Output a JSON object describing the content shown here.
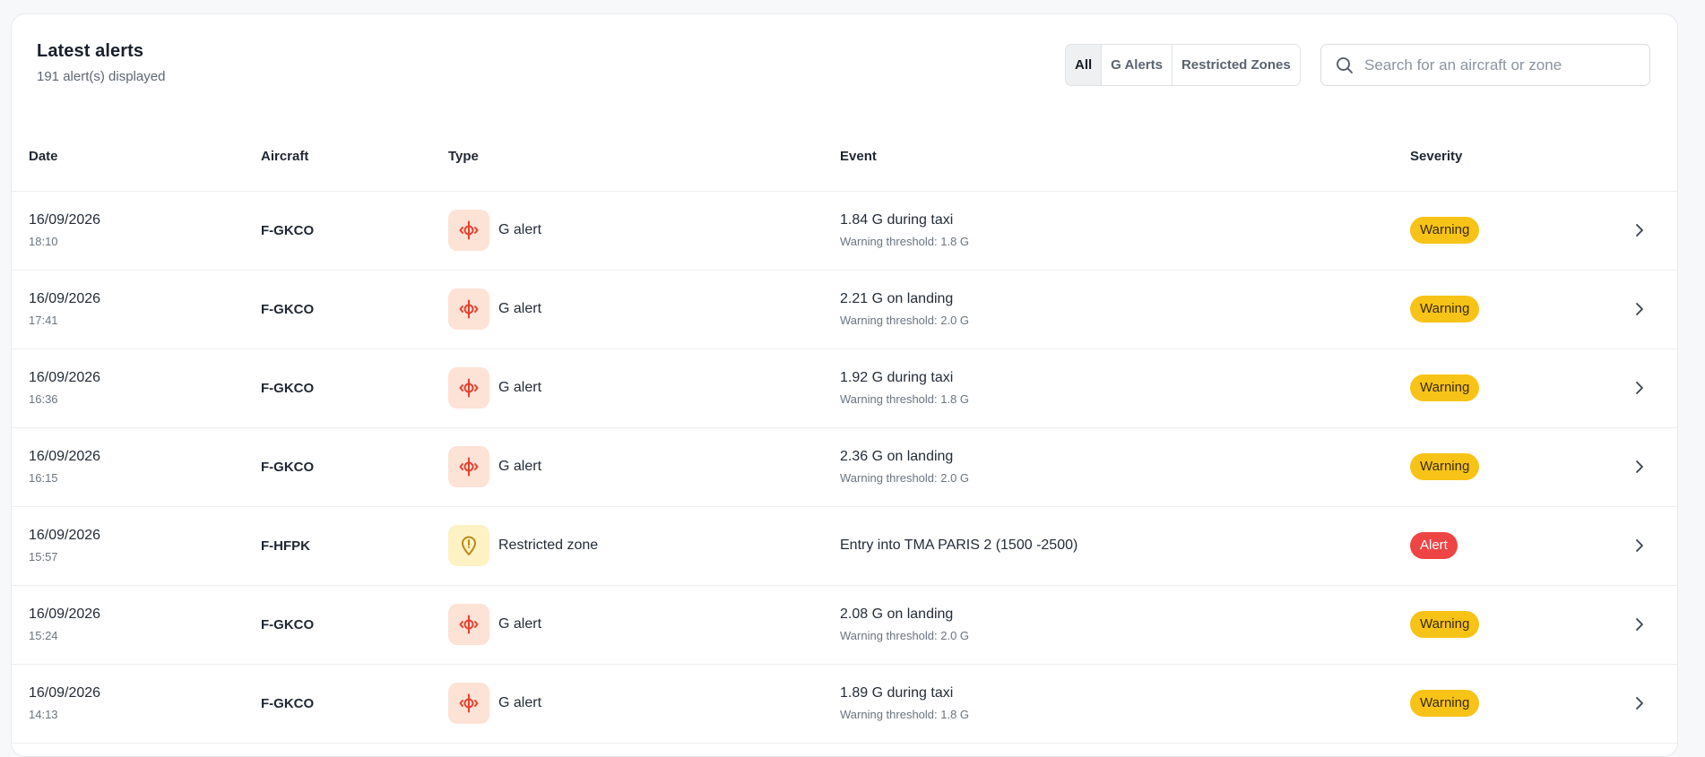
{
  "header": {
    "title": "Latest alerts",
    "subtitle": "191 alert(s) displayed"
  },
  "filters": [
    {
      "label": "All",
      "active": true
    },
    {
      "label": "G Alerts",
      "active": false
    },
    {
      "label": "Restricted Zones",
      "active": false
    }
  ],
  "search": {
    "placeholder": "Search for an aircraft or zone",
    "value": ""
  },
  "table": {
    "columns": [
      "Date",
      "Aircraft",
      "Type",
      "Event",
      "Severity"
    ],
    "rows": [
      {
        "date": "16/09/2026",
        "time": "18:10",
        "aircraft": "F-GKCO",
        "type": "G alert",
        "type_icon": "g-force-icon",
        "event": "1.84 G during taxi",
        "threshold": "Warning threshold: 1.8 G",
        "severity": "Warning"
      },
      {
        "date": "16/09/2026",
        "time": "17:41",
        "aircraft": "F-GKCO",
        "type": "G alert",
        "type_icon": "g-force-icon",
        "event": "2.21 G on landing",
        "threshold": "Warning threshold: 2.0 G",
        "severity": "Warning"
      },
      {
        "date": "16/09/2026",
        "time": "16:36",
        "aircraft": "F-GKCO",
        "type": "G alert",
        "type_icon": "g-force-icon",
        "event": "1.92 G during taxi",
        "threshold": "Warning threshold: 1.8 G",
        "severity": "Warning"
      },
      {
        "date": "16/09/2026",
        "time": "16:15",
        "aircraft": "F-GKCO",
        "type": "G alert",
        "type_icon": "g-force-icon",
        "event": "2.36 G on landing",
        "threshold": "Warning threshold: 2.0 G",
        "severity": "Warning"
      },
      {
        "date": "16/09/2026",
        "time": "15:57",
        "aircraft": "F-HFPK",
        "type": "Restricted zone",
        "type_icon": "location-pin-icon",
        "event": "Entry into TMA PARIS 2 (1500 -2500)",
        "threshold": "",
        "severity": "Alert"
      },
      {
        "date": "16/09/2026",
        "time": "15:24",
        "aircraft": "F-GKCO",
        "type": "G alert",
        "type_icon": "g-force-icon",
        "event": "2.08 G on landing",
        "threshold": "Warning threshold: 2.0 G",
        "severity": "Warning"
      },
      {
        "date": "16/09/2026",
        "time": "14:13",
        "aircraft": "F-GKCO",
        "type": "G alert",
        "type_icon": "g-force-icon",
        "event": "1.89 G during taxi",
        "threshold": "Warning threshold: 1.8 G",
        "severity": "Warning"
      }
    ]
  },
  "colors": {
    "warning": "#f7c317",
    "alert": "#ef4444",
    "g_icon": "#e8412f",
    "zone_icon": "#b9891a"
  }
}
